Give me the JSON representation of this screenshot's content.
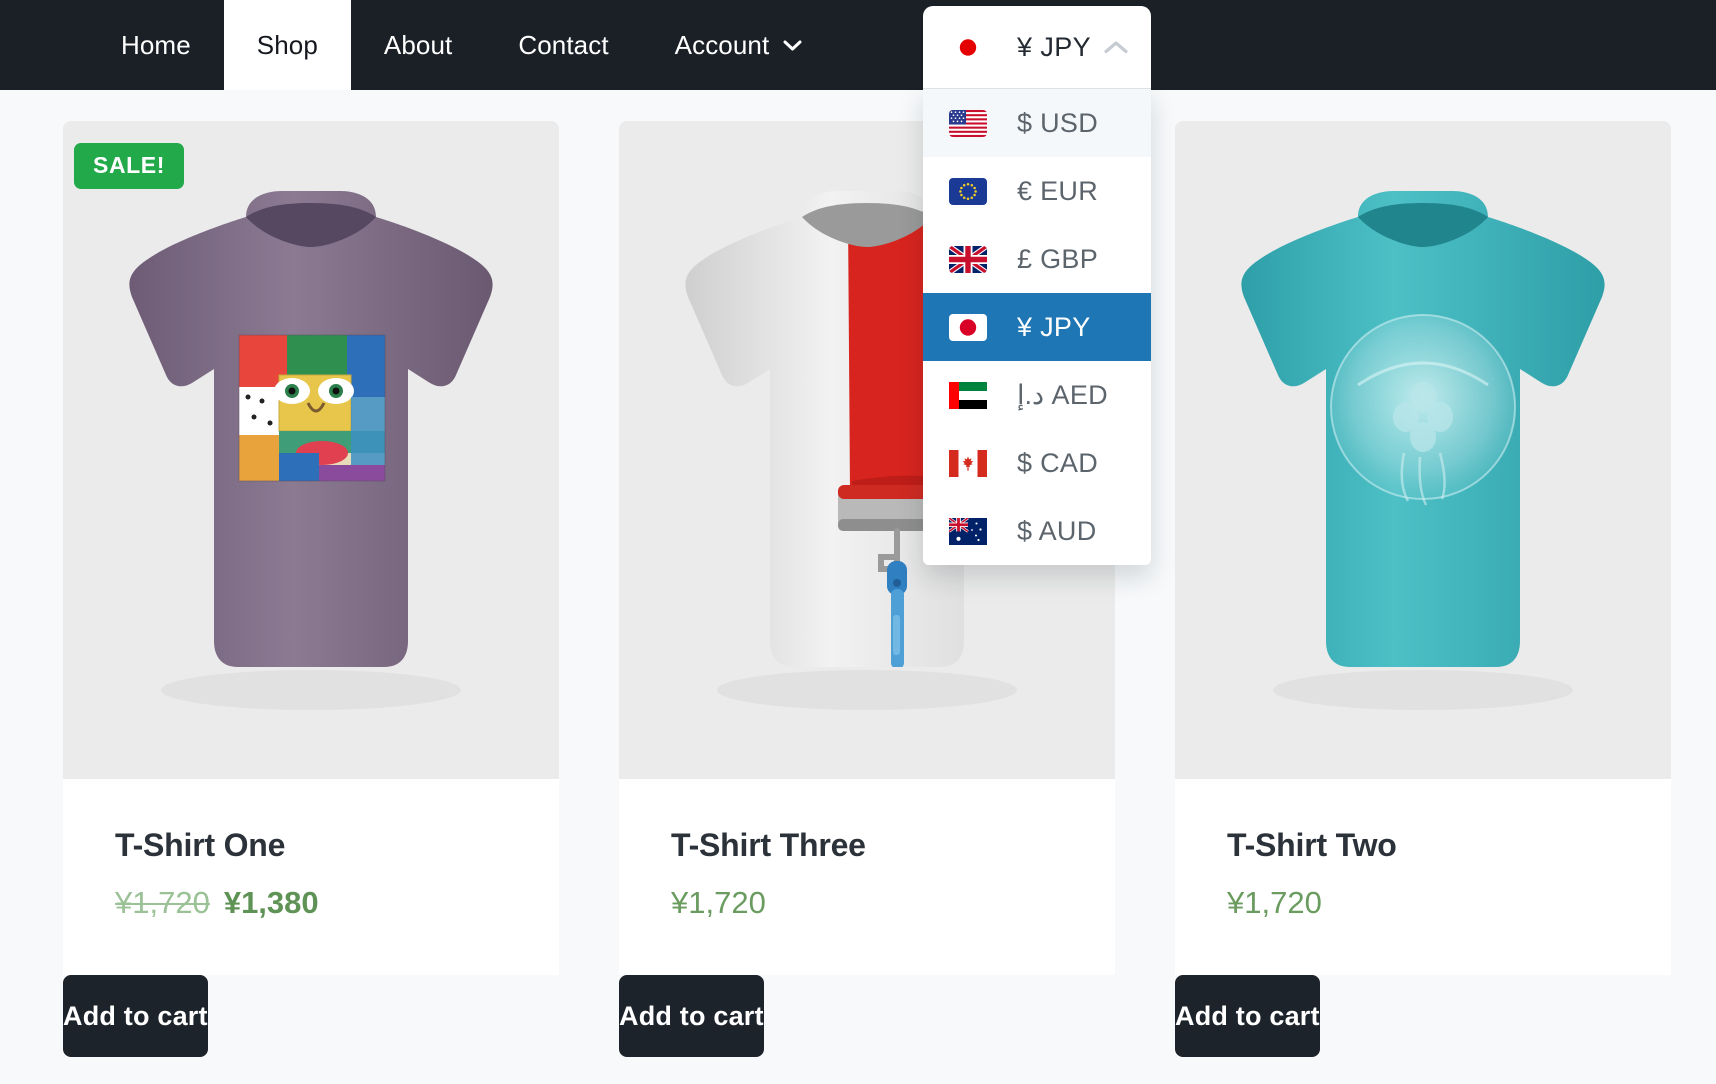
{
  "nav": {
    "items": [
      {
        "label": "Home",
        "active": false,
        "caret": false
      },
      {
        "label": "Shop",
        "active": true,
        "caret": false
      },
      {
        "label": "About",
        "active": false,
        "caret": false
      },
      {
        "label": "Contact",
        "active": false,
        "caret": false
      },
      {
        "label": "Account",
        "active": false,
        "caret": true
      }
    ]
  },
  "currency_selector": {
    "selected_flag": "japan-flag-icon",
    "selected_symbol": "¥",
    "selected_code": "JPY",
    "selected_label": "¥ JPY",
    "chevron": "chevron-up-icon",
    "expanded": true,
    "options": [
      {
        "flag": "usa-flag-icon",
        "symbol": "$",
        "code": "USD",
        "label": "$ USD",
        "state": "hovered"
      },
      {
        "flag": "eu-flag-icon",
        "symbol": "€",
        "code": "EUR",
        "label": "€ EUR",
        "state": "normal"
      },
      {
        "flag": "uk-flag-icon",
        "symbol": "£",
        "code": "GBP",
        "label": "£ GBP",
        "state": "normal"
      },
      {
        "flag": "japan-flag-icon",
        "symbol": "¥",
        "code": "JPY",
        "label": "¥ JPY",
        "state": "selected"
      },
      {
        "flag": "uae-flag-icon",
        "symbol": "د.إ",
        "code": "AED",
        "label": "د.إ AED",
        "state": "normal"
      },
      {
        "flag": "canada-flag-icon",
        "symbol": "$",
        "code": "CAD",
        "label": "$ CAD",
        "state": "normal"
      },
      {
        "flag": "australia-flag-icon",
        "symbol": "$",
        "code": "AUD",
        "label": "$ AUD",
        "state": "normal"
      }
    ]
  },
  "products": [
    {
      "title": "T-Shirt One",
      "badge": "SALE!",
      "on_sale": true,
      "price_old": "¥1,720",
      "price_new": "¥1,380",
      "add_label": "Add to cart",
      "shirt": "purple-picasso-tee"
    },
    {
      "title": "T-Shirt Three",
      "badge": "",
      "on_sale": false,
      "price": "¥1,720",
      "add_label": "Add to cart",
      "shirt": "white-red-roller-tee"
    },
    {
      "title": "T-Shirt Two",
      "badge": "",
      "on_sale": false,
      "price": "¥1,720",
      "add_label": "Add to cart",
      "shirt": "teal-jellyfish-tee"
    }
  ],
  "colors": {
    "navbar_bg": "#1b2027",
    "sale_badge": "#22a94a",
    "button_bg": "#1d232b",
    "selected_option_bg": "#1f76b4",
    "price_green": "#6a9b5f",
    "price_old_green": "#9bc196",
    "page_bg": "#f7f9fb"
  }
}
